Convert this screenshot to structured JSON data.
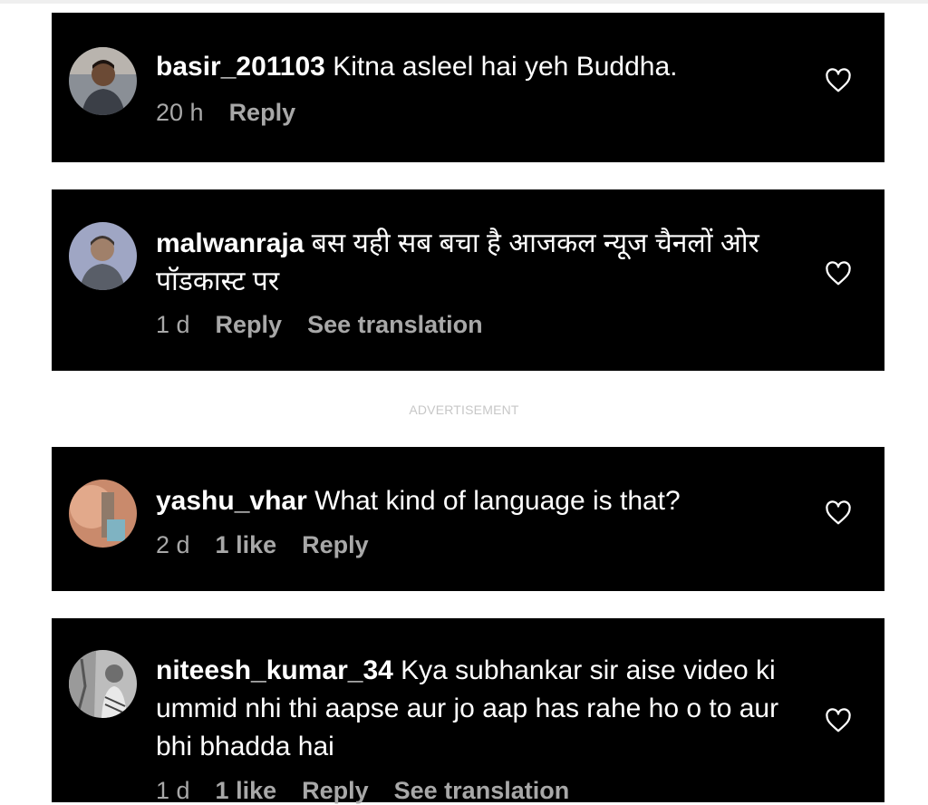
{
  "advertisement_label": "ADVERTISEMENT",
  "comments": [
    {
      "username": "basir_201103",
      "text": "Kitna asleel hai yeh Buddha.",
      "time": "20 h",
      "likes": "",
      "reply_label": "Reply",
      "translation_label": ""
    },
    {
      "username": "malwanraja",
      "text": "बस यही सब बचा है आजकल न्यूज चैनलों ओर पॉडकास्ट पर",
      "time": "1 d",
      "likes": "",
      "reply_label": "Reply",
      "translation_label": "See translation"
    },
    {
      "username": "yashu_vhar",
      "text": "What kind of language is that?",
      "time": "2 d",
      "likes": "1 like",
      "reply_label": "Reply",
      "translation_label": ""
    },
    {
      "username": "niteesh_kumar_34",
      "text": "Kya subhankar sir aise video ki ummid nhi thi aapse aur jo aap has rahe ho o to aur bhi bhadda hai",
      "time": "1 d",
      "likes": "1 like",
      "reply_label": "Reply",
      "translation_label": "See translation"
    }
  ]
}
